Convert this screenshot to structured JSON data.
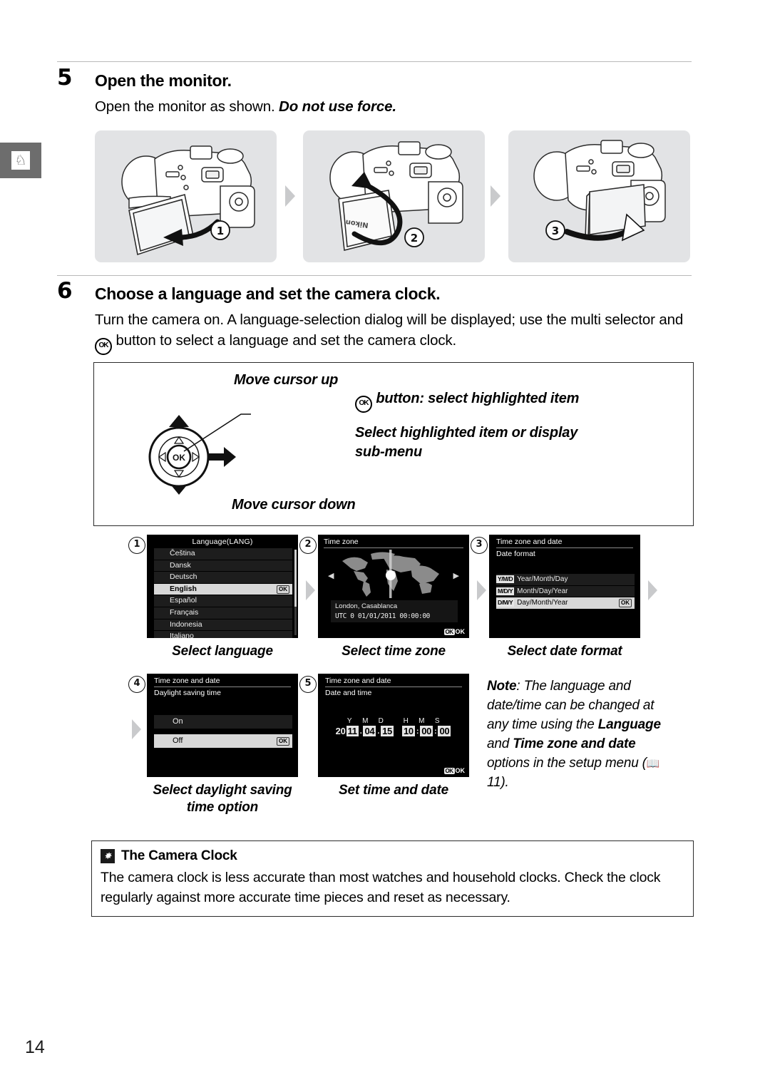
{
  "page": {
    "number": "14",
    "side_tab_icon": "weathervane-icon"
  },
  "step5": {
    "number": "5",
    "title": "Open the monitor.",
    "body_plain": "Open the monitor as shown. ",
    "body_italic": "Do not use force.",
    "illustrations": [
      {
        "badge": "1",
        "name": "camera-monitor-swing-out"
      },
      {
        "badge": "2",
        "name": "camera-monitor-rotate"
      },
      {
        "badge": "3",
        "name": "camera-monitor-closed-facing-out"
      }
    ]
  },
  "step6": {
    "number": "6",
    "title": "Choose a language and set the camera clock.",
    "body_part1": "Turn the camera on.  A language-selection dialog will be displayed; use the multi selector and ",
    "body_part2": " button to select a language and set the camera clock."
  },
  "multi_selector": {
    "up_label": "Move cursor up",
    "down_label": "Move cursor down",
    "ok_label": " button: select highlighted item",
    "right_label": "Select highlighted item or display sub-menu",
    "ok_text": "OK"
  },
  "screens": [
    {
      "badge": "1",
      "caption": "Select language",
      "title": "Language(LANG)",
      "items": [
        {
          "label": "Čeština",
          "highlighted": false
        },
        {
          "label": "Dansk",
          "highlighted": false
        },
        {
          "label": "Deutsch",
          "highlighted": false
        },
        {
          "label": "English",
          "highlighted": true,
          "ok": "OK"
        },
        {
          "label": "Español",
          "highlighted": false
        },
        {
          "label": "Français",
          "highlighted": false
        },
        {
          "label": "Indonesia",
          "highlighted": false
        },
        {
          "label": "Italiano",
          "highlighted": false
        }
      ]
    },
    {
      "badge": "2",
      "caption": "Select time zone",
      "title": "Time zone",
      "city": "London, Casablanca",
      "utc": "UTC 0      01/01/2011 00:00:00",
      "ok_corner": "OK"
    },
    {
      "badge": "3",
      "caption": "Select date format",
      "title": "Time zone and date",
      "subtitle": "Date format",
      "rows": [
        {
          "key": "Y/M/D",
          "label": "Year/Month/Day",
          "highlighted": false
        },
        {
          "key": "M/D/Y",
          "label": "Month/Day/Year",
          "highlighted": false
        },
        {
          "key": "D/M/Y",
          "label": "Day/Month/Year",
          "highlighted": true,
          "ok": "OK"
        }
      ]
    },
    {
      "badge": "4",
      "caption_line1": "Select daylight saving",
      "caption_line2": "time option",
      "title": "Time zone and date",
      "subtitle": "Daylight saving time",
      "rows": [
        {
          "label": "On",
          "highlighted": false
        },
        {
          "label": "Off",
          "highlighted": true,
          "ok": "OK"
        }
      ]
    },
    {
      "badge": "5",
      "caption": "Set time and date",
      "title": "Time zone and date",
      "subtitle": "Date and time",
      "labels": [
        "Y",
        "M",
        "D",
        "H",
        "M",
        "S"
      ],
      "century": "20",
      "values": [
        "11",
        "04",
        "15",
        "10",
        "00",
        "00"
      ],
      "ok_corner": "OK"
    }
  ],
  "note": {
    "lead": "Note",
    "text1": ": The language and date/time can be changed at any time using the ",
    "bold1": "Language",
    "text2": " and ",
    "bold2": "Time zone and date",
    "text3": " options in the setup menu (",
    "page_ref": "11",
    "text4": ")."
  },
  "camera_clock": {
    "title": "The Camera Clock",
    "body": "The camera clock is less accurate than most watches and household clocks.  Check the clock regularly against more accurate time pieces and reset as necessary."
  }
}
